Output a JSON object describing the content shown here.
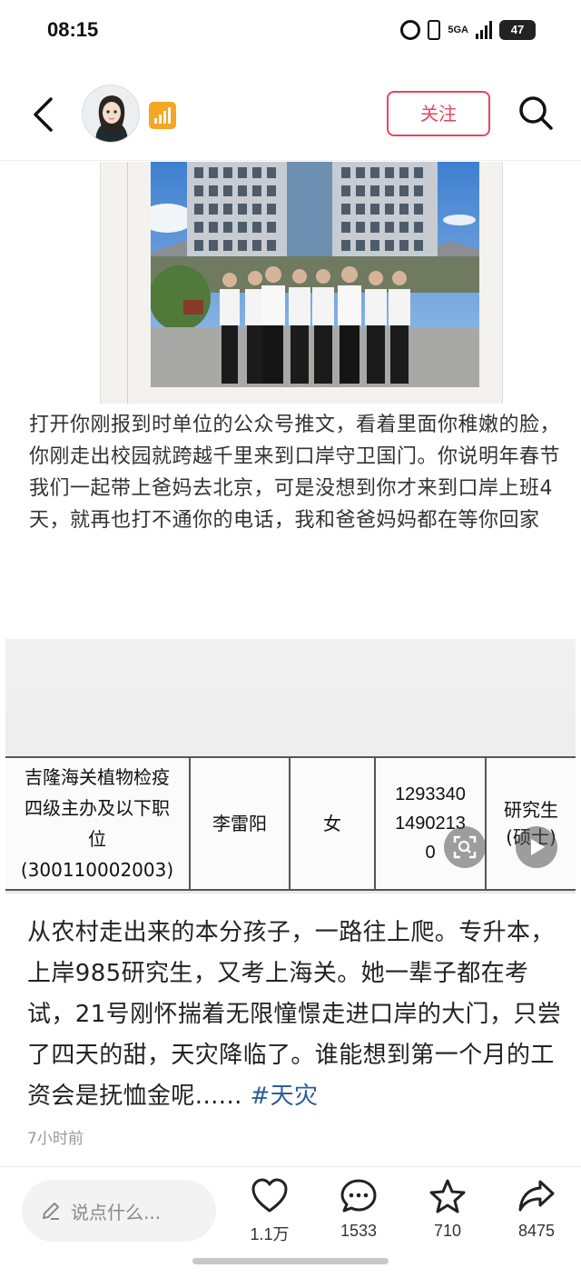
{
  "status_bar": {
    "time": "08:15",
    "network": "5GA",
    "battery": "47"
  },
  "header": {
    "follow_label": "关注"
  },
  "post": {
    "paragraph1": "打开你刚报到时单位的公众号推文，看着里面你稚嫩的脸，你刚走出校园就跨越千里来到口岸守卫国门。你说明年春节我们一起带上爸妈去北京，可是没想到你才来到口岸上班4天，就再也打不通你的电话，我和爸爸妈妈都在等你回家",
    "table_row": {
      "position_line1": "吉隆海关植物检疫",
      "position_line2": "四级主办及以下职",
      "position_line3": "位",
      "position_code": "(300110002003)",
      "name": "李雷阳",
      "gender": "女",
      "id_line1": "1293340",
      "id_line2": "1490213",
      "id_line3": "0",
      "education_line1": "研究生",
      "education_line2": "(硕士)"
    },
    "paragraph2": "从农村走出来的本分孩子，一路往上爬。专升本，上岸985研究生，又考上海关。她一辈子都在考试，21号刚怀揣着无限憧憬走进口岸的大门，只尝了四天的甜，天灾降临了。谁能想到第一个月的工资会是抚恤金呢......",
    "hashtag": "#天灾",
    "timestamp": "7小时前"
  },
  "bottom_bar": {
    "comment_placeholder": "说点什么...",
    "likes": "1.1万",
    "comments": "1533",
    "favorites": "710",
    "shares": "8475"
  },
  "colors": {
    "accent": "#e8455a",
    "hashtag": "#2e5c9a",
    "level_badge": "#f5a623"
  },
  "icons": [
    "back-icon",
    "search-icon",
    "level-badge-icon",
    "alarm-icon",
    "vibrate-icon",
    "signal-icon",
    "battery-icon",
    "pencil-icon",
    "heart-icon",
    "comment-icon",
    "star-icon",
    "share-icon",
    "image-scan-icon",
    "play-icon"
  ]
}
